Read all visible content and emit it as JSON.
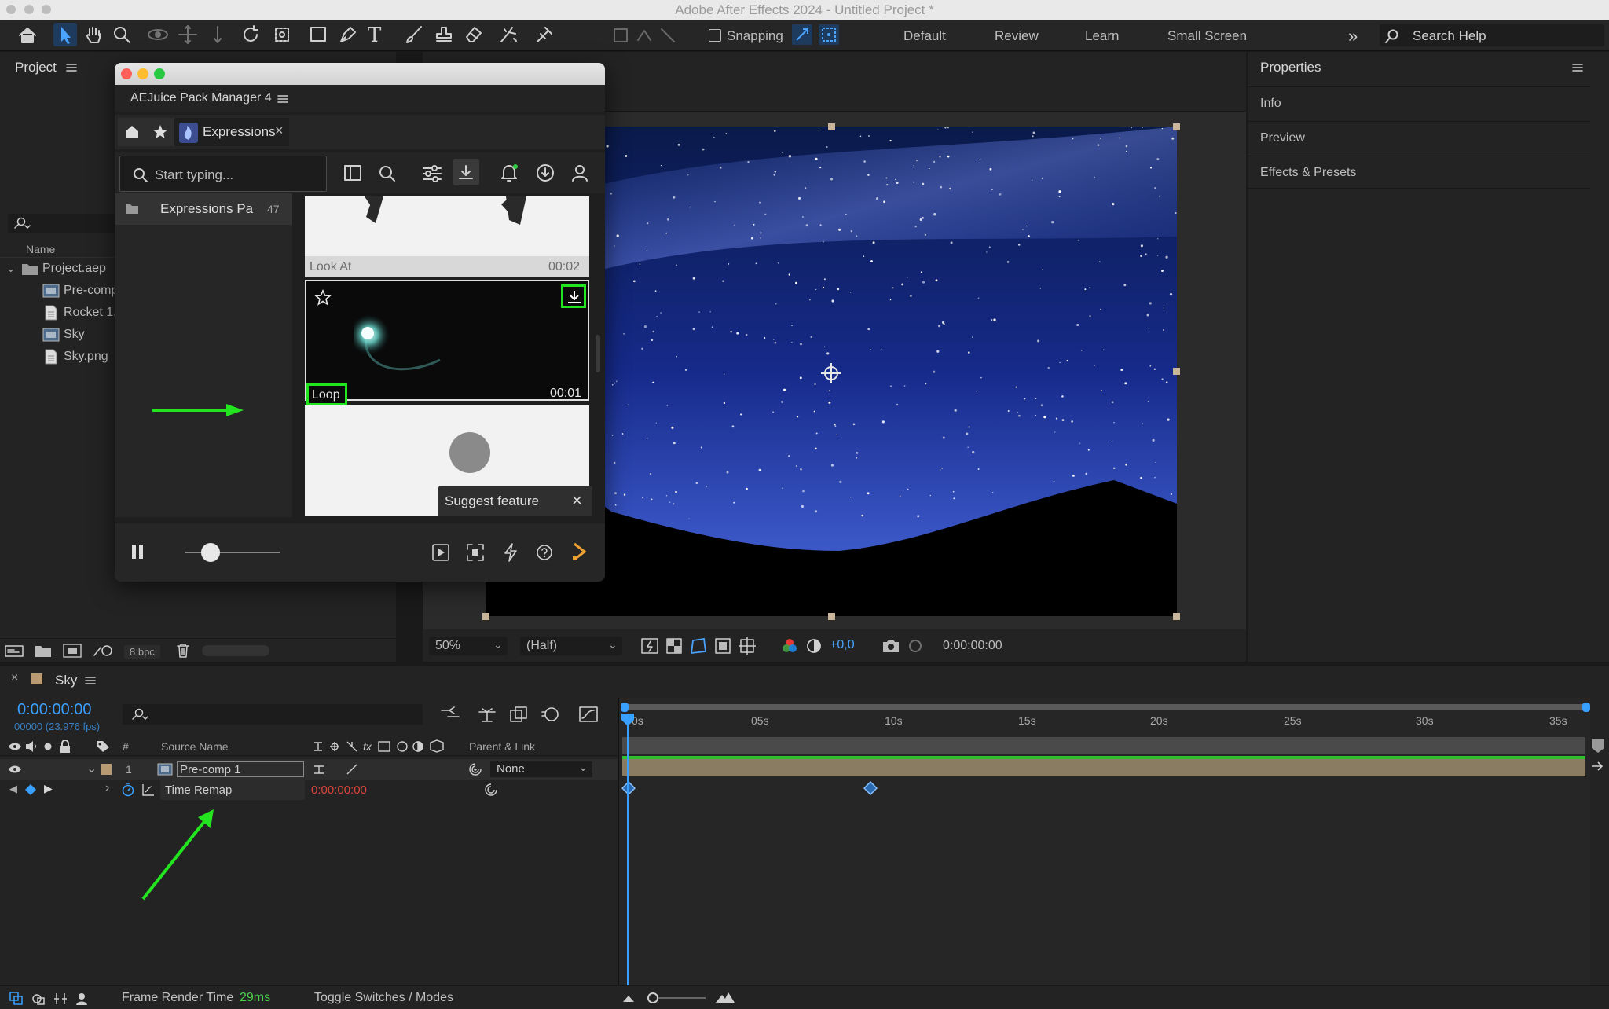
{
  "app": {
    "title": "Adobe After Effects 2024 - Untitled Project *"
  },
  "toolbar": {
    "snapping_label": "Snapping",
    "workspaces": [
      "Default",
      "Review",
      "Learn",
      "Small Screen"
    ],
    "search_placeholder": "Search Help"
  },
  "project_panel": {
    "title": "Project",
    "column_name": "Name",
    "items": [
      {
        "label": "Project.aep",
        "icon": "folder-icon"
      },
      {
        "label": "Pre-comp",
        "icon": "composition-icon"
      },
      {
        "label": "Rocket 1.",
        "icon": "file-icon"
      },
      {
        "label": "Sky",
        "icon": "composition-icon"
      },
      {
        "label": "Sky.png",
        "icon": "file-icon"
      }
    ],
    "bpc": "8 bpc"
  },
  "plugin": {
    "title": "AEJuice Pack Manager 4",
    "tab_label": "Expressions",
    "search_placeholder": "Start typing...",
    "folder": {
      "label": "Expressions Pa",
      "count": "47"
    },
    "cards": [
      {
        "name": "Look At",
        "duration": "00:02"
      },
      {
        "name": "Loop",
        "duration": "00:01"
      }
    ],
    "suggest_label": "Suggest feature"
  },
  "viewer": {
    "zoom": "50%",
    "resolution": "(Half)",
    "exposure": "+0,0",
    "timecode": "0:00:00:00"
  },
  "properties_panel": {
    "title": "Properties",
    "sections": [
      "Info",
      "Preview",
      "Effects & Presets"
    ]
  },
  "timeline": {
    "comp_name": "Sky",
    "timecode": "0:00:00:00",
    "frame_info": "00000 (23.976 fps)",
    "columns": {
      "num": "#",
      "source": "Source Name",
      "parent": "Parent & Link"
    },
    "ruler": [
      "0s",
      "05s",
      "10s",
      "15s",
      "20s",
      "25s",
      "30s",
      "35s"
    ],
    "layer": {
      "index": "1",
      "name": "Pre-comp 1",
      "parent": "None"
    },
    "property": {
      "name": "Time Remap",
      "value": "0:00:00:00"
    },
    "footer": {
      "render_label": "Frame Render Time",
      "render_value": "29ms",
      "toggle_label": "Toggle Switches / Modes"
    }
  },
  "colors": {
    "accent": "#2d8ceb",
    "highlight_green": "#22e51f",
    "value_red": "#d9453a",
    "layer_bar": "#8a7c62"
  }
}
